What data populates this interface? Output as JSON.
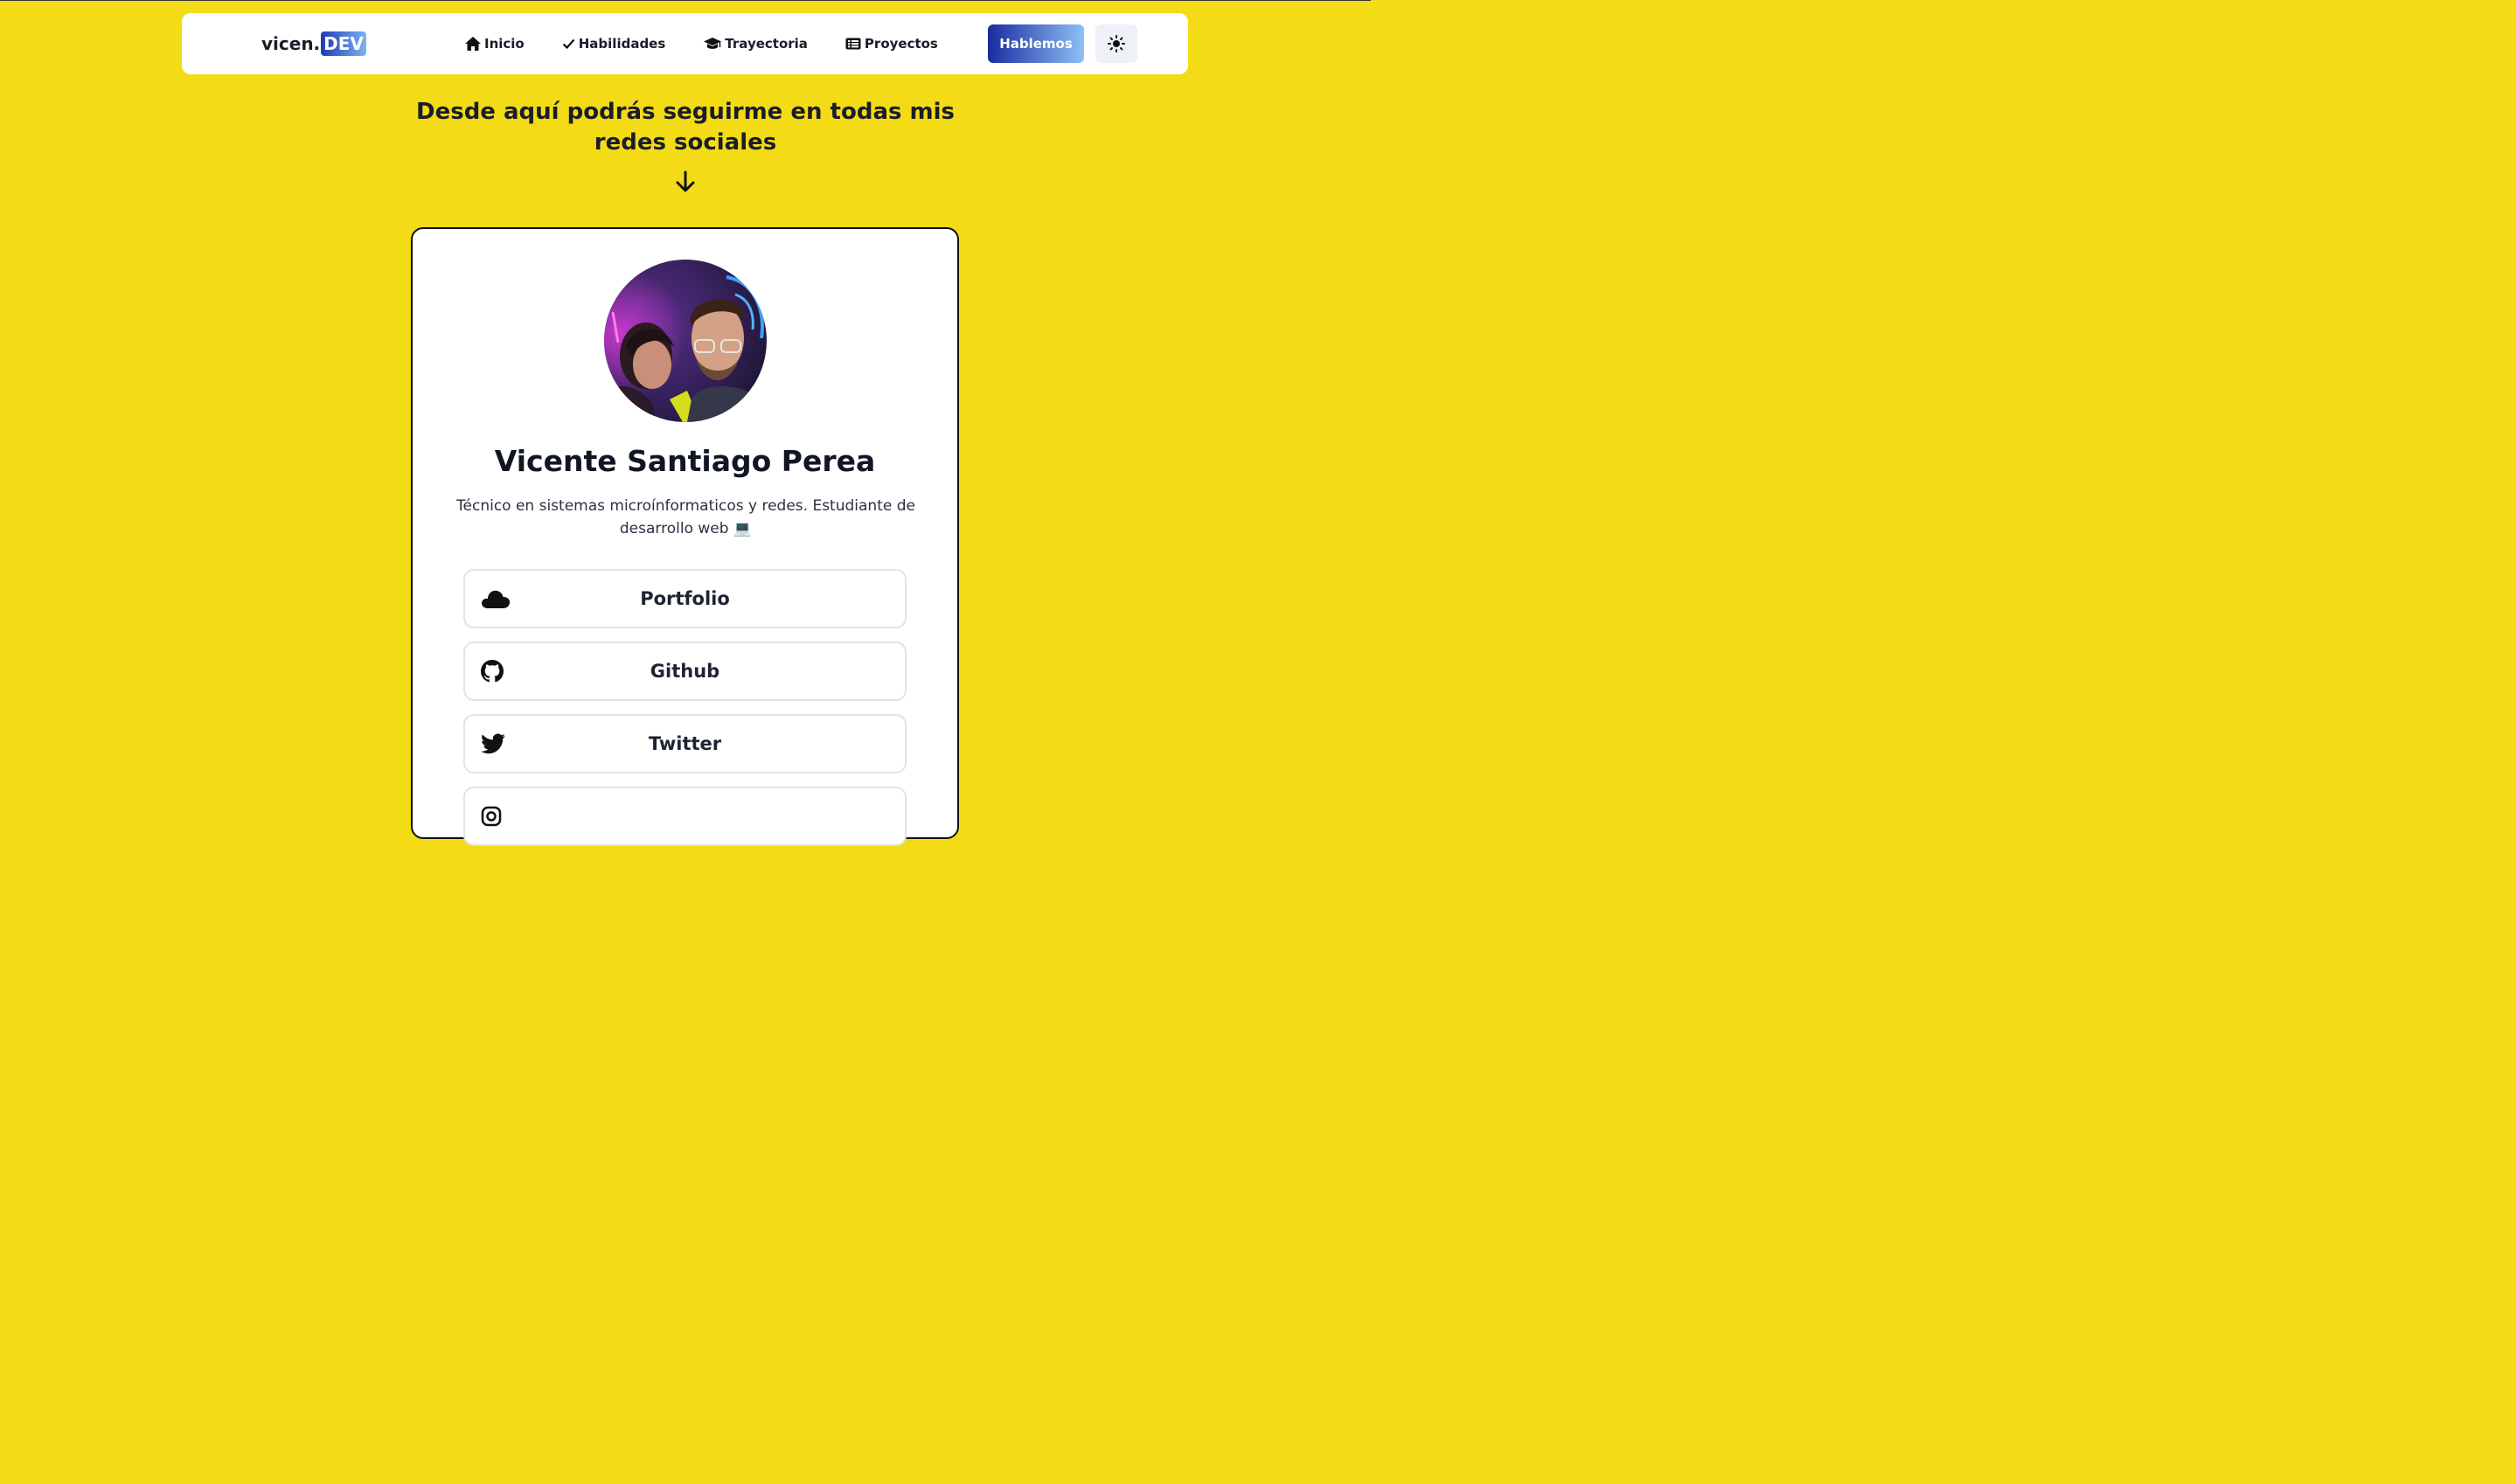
{
  "navbar": {
    "logo_text": "vicen.",
    "logo_badge": "DEV",
    "links": [
      {
        "label": "Inicio",
        "icon": "home-icon"
      },
      {
        "label": "Habilidades",
        "icon": "check-icon"
      },
      {
        "label": "Trayectoria",
        "icon": "graduation-cap-icon"
      },
      {
        "label": "Proyectos",
        "icon": "list-icon"
      }
    ],
    "cta_label": "Hablemos",
    "theme_icon": "sun-icon"
  },
  "intro": {
    "headline": "Desde aquí podrás seguirme en todas mis redes sociales",
    "arrow_icon": "arrow-down-icon"
  },
  "profile": {
    "name": "Vicente Santiago Perea",
    "bio": "Técnico en sistemas microínformaticos y redes. Estudiante de desarrollo web 💻",
    "links": [
      {
        "label": "Portfolio",
        "icon": "cloud-icon"
      },
      {
        "label": "Github",
        "icon": "github-icon"
      },
      {
        "label": "Twitter",
        "icon": "twitter-icon"
      }
    ]
  },
  "colors": {
    "background": "#f3db16",
    "cta_gradient_start": "#1a2ba0",
    "cta_gradient_end": "#8ec0f5",
    "text": "#1a1d29"
  }
}
